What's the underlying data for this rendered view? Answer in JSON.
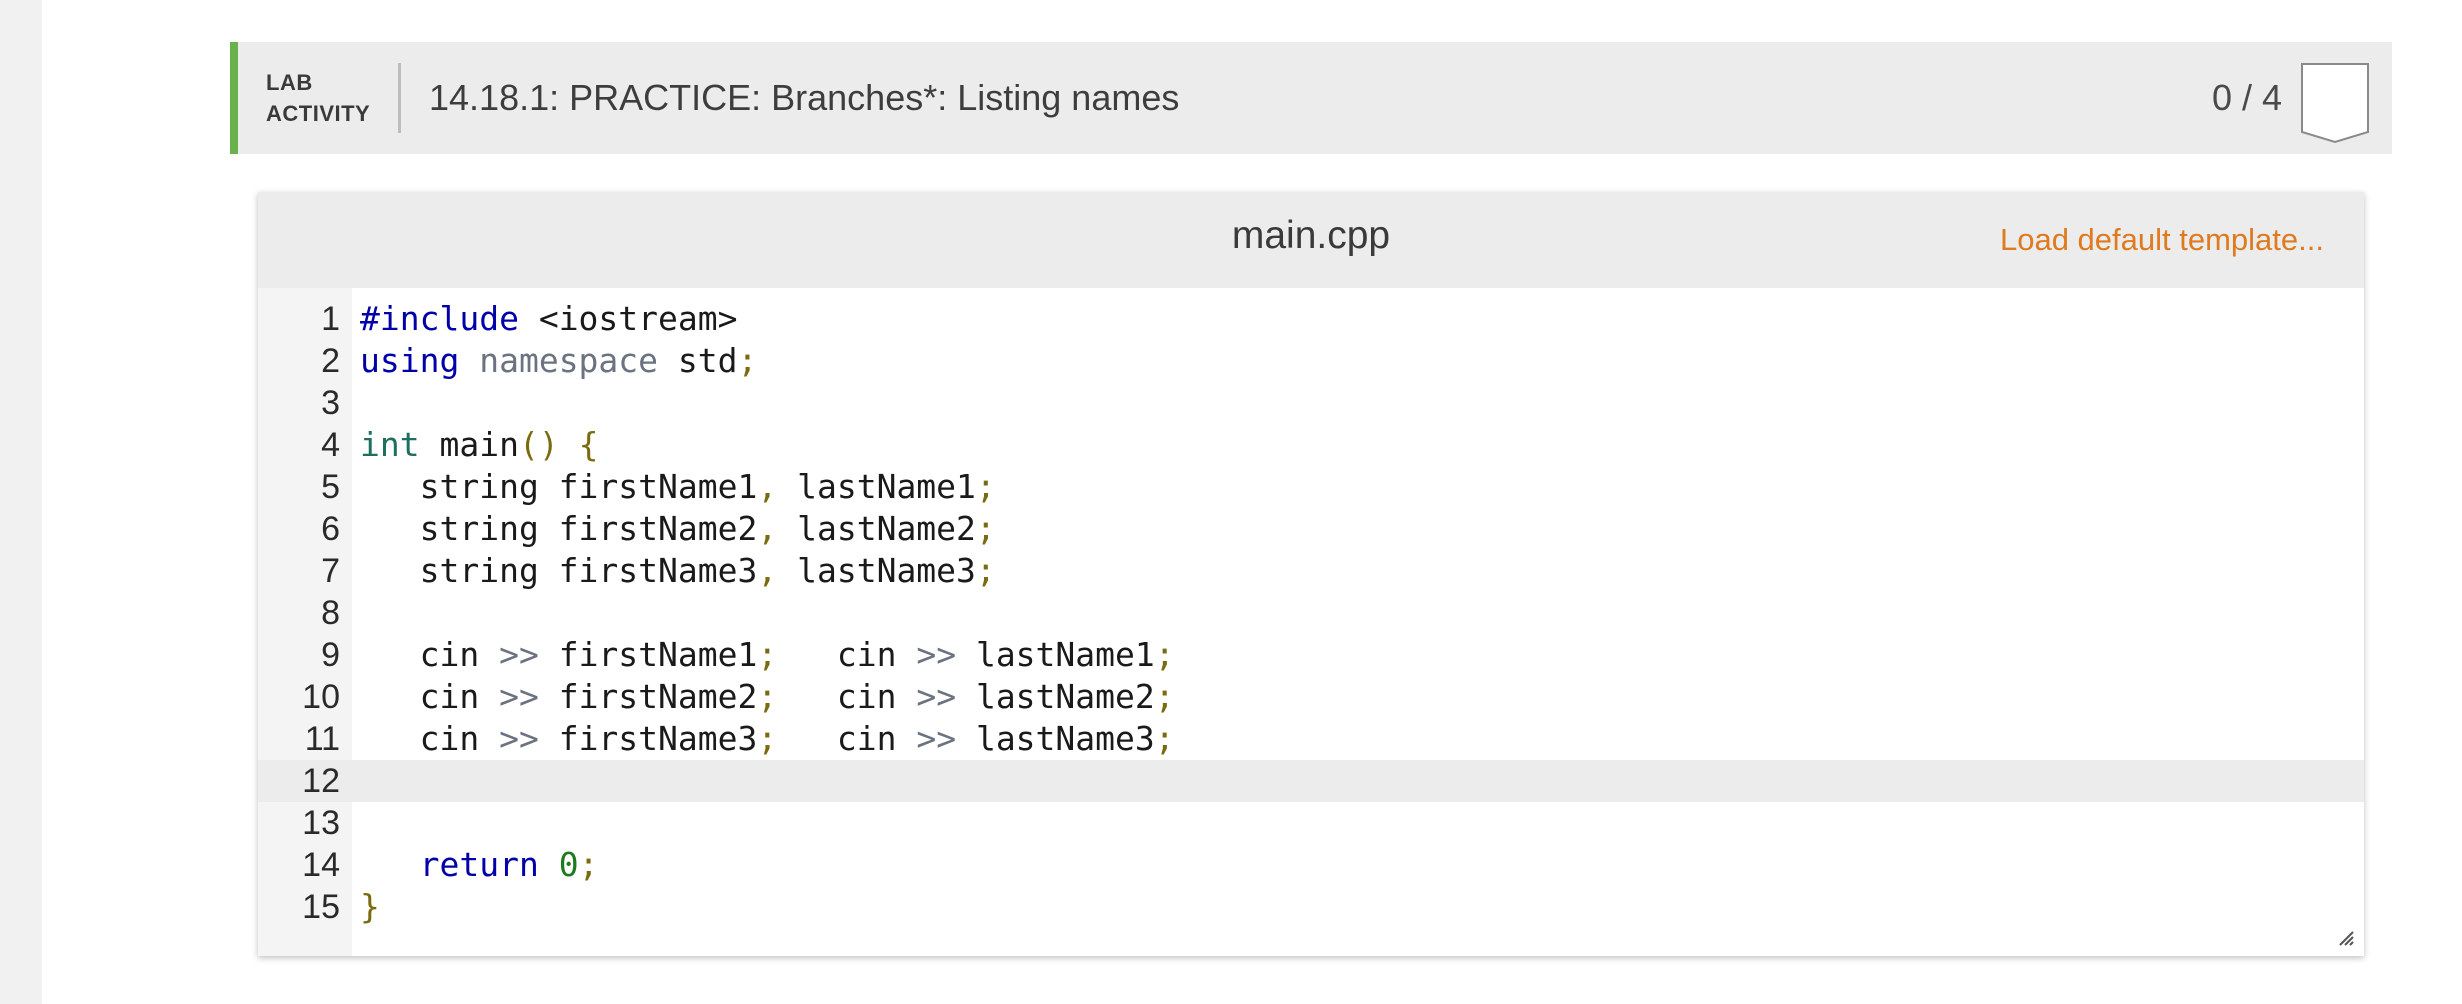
{
  "lab": {
    "badge_line1": "LAB",
    "badge_line2": "ACTIVITY",
    "title": "14.18.1: PRACTICE: Branches*: Listing names",
    "score": "0 / 4"
  },
  "editor": {
    "file_name": "main.cpp",
    "load_template_label": "Load default template...",
    "active_line": 12,
    "lines": [
      {
        "n": "1",
        "tokens": [
          [
            "kw",
            "#include"
          ],
          [
            "def",
            " <iostream>"
          ]
        ]
      },
      {
        "n": "2",
        "tokens": [
          [
            "kw",
            "using"
          ],
          [
            "def",
            " "
          ],
          [
            "ns",
            "namespace"
          ],
          [
            "def",
            " std"
          ],
          [
            "punc",
            ";"
          ]
        ]
      },
      {
        "n": "3",
        "tokens": []
      },
      {
        "n": "4",
        "tokens": [
          [
            "type",
            "int"
          ],
          [
            "def",
            " main"
          ],
          [
            "punc",
            "()"
          ],
          [
            "def",
            " "
          ],
          [
            "punc",
            "{"
          ]
        ]
      },
      {
        "n": "5",
        "tokens": [
          [
            "def",
            "   string firstName1"
          ],
          [
            "punc",
            ","
          ],
          [
            "def",
            " lastName1"
          ],
          [
            "punc",
            ";"
          ]
        ]
      },
      {
        "n": "6",
        "tokens": [
          [
            "def",
            "   string firstName2"
          ],
          [
            "punc",
            ","
          ],
          [
            "def",
            " lastName2"
          ],
          [
            "punc",
            ";"
          ]
        ]
      },
      {
        "n": "7",
        "tokens": [
          [
            "def",
            "   string firstName3"
          ],
          [
            "punc",
            ","
          ],
          [
            "def",
            " lastName3"
          ],
          [
            "punc",
            ";"
          ]
        ]
      },
      {
        "n": "8",
        "tokens": []
      },
      {
        "n": "9",
        "tokens": [
          [
            "def",
            "   cin "
          ],
          [
            "op",
            ">>"
          ],
          [
            "def",
            " firstName1"
          ],
          [
            "punc",
            ";"
          ],
          [
            "def",
            "   cin "
          ],
          [
            "op",
            ">>"
          ],
          [
            "def",
            " lastName1"
          ],
          [
            "punc",
            ";"
          ]
        ]
      },
      {
        "n": "10",
        "tokens": [
          [
            "def",
            "   cin "
          ],
          [
            "op",
            ">>"
          ],
          [
            "def",
            " firstName2"
          ],
          [
            "punc",
            ";"
          ],
          [
            "def",
            "   cin "
          ],
          [
            "op",
            ">>"
          ],
          [
            "def",
            " lastName2"
          ],
          [
            "punc",
            ";"
          ]
        ]
      },
      {
        "n": "11",
        "tokens": [
          [
            "def",
            "   cin "
          ],
          [
            "op",
            ">>"
          ],
          [
            "def",
            " firstName3"
          ],
          [
            "punc",
            ";"
          ],
          [
            "def",
            "   cin "
          ],
          [
            "op",
            ">>"
          ],
          [
            "def",
            " lastName3"
          ],
          [
            "punc",
            ";"
          ]
        ]
      },
      {
        "n": "12",
        "tokens": []
      },
      {
        "n": "13",
        "tokens": []
      },
      {
        "n": "14",
        "tokens": [
          [
            "def",
            "   "
          ],
          [
            "kw",
            "return"
          ],
          [
            "def",
            " "
          ],
          [
            "num",
            "0"
          ],
          [
            "punc",
            ";"
          ]
        ]
      },
      {
        "n": "15",
        "tokens": [
          [
            "punc",
            "}"
          ]
        ]
      }
    ]
  },
  "colors": {
    "accent_green": "#6ab04c",
    "link_orange": "#e07a1f"
  },
  "icons": {
    "score_flag": "score-flag-icon",
    "resize": "resize-handle-icon"
  }
}
